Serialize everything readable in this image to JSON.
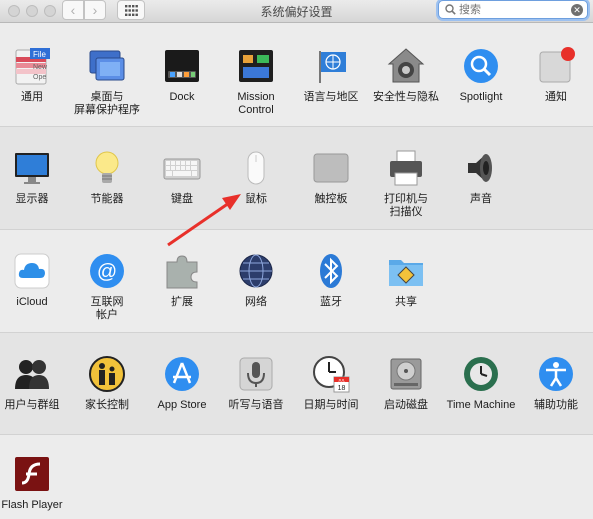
{
  "window": {
    "title": "系统偏好设置"
  },
  "toolbar": {
    "back": "‹",
    "forward": "›"
  },
  "search": {
    "placeholder": "搜索",
    "clear": "✕"
  },
  "rows": [
    [
      {
        "label": "通用",
        "icon": "general-icon"
      },
      {
        "label": "桌面与\n屏幕保护程序",
        "icon": "desktop-screensaver-icon"
      },
      {
        "label": "Dock",
        "icon": "dock-icon"
      },
      {
        "label": "Mission\nControl",
        "icon": "mission-control-icon"
      },
      {
        "label": "语言与地区",
        "icon": "language-region-icon"
      },
      {
        "label": "安全性与隐私",
        "icon": "security-privacy-icon"
      },
      {
        "label": "Spotlight",
        "icon": "spotlight-icon"
      },
      {
        "label": "通知",
        "icon": "notifications-icon"
      }
    ],
    [
      {
        "label": "显示器",
        "icon": "displays-icon"
      },
      {
        "label": "节能器",
        "icon": "energy-saver-icon"
      },
      {
        "label": "键盘",
        "icon": "keyboard-icon"
      },
      {
        "label": "鼠标",
        "icon": "mouse-icon"
      },
      {
        "label": "触控板",
        "icon": "trackpad-icon"
      },
      {
        "label": "打印机与\n扫描仪",
        "icon": "printers-scanners-icon"
      },
      {
        "label": "声音",
        "icon": "sound-icon"
      }
    ],
    [
      {
        "label": "iCloud",
        "icon": "icloud-icon"
      },
      {
        "label": "互联网\n帐户",
        "icon": "internet-accounts-icon"
      },
      {
        "label": "扩展",
        "icon": "extensions-icon"
      },
      {
        "label": "网络",
        "icon": "network-icon"
      },
      {
        "label": "蓝牙",
        "icon": "bluetooth-icon"
      },
      {
        "label": "共享",
        "icon": "sharing-icon"
      }
    ],
    [
      {
        "label": "用户与群组",
        "icon": "users-groups-icon"
      },
      {
        "label": "家长控制",
        "icon": "parental-controls-icon"
      },
      {
        "label": "App Store",
        "icon": "app-store-icon"
      },
      {
        "label": "听写与语音",
        "icon": "dictation-speech-icon"
      },
      {
        "label": "日期与时间",
        "icon": "date-time-icon"
      },
      {
        "label": "启动磁盘",
        "icon": "startup-disk-icon"
      },
      {
        "label": "Time Machine",
        "icon": "time-machine-icon"
      },
      {
        "label": "辅助功能",
        "icon": "accessibility-icon"
      }
    ],
    [
      {
        "label": "Flash Player",
        "icon": "flash-player-icon"
      }
    ]
  ],
  "icon_text": {
    "file_badge": "File",
    "file_new": "New",
    "file_ope": "Ope",
    "calendar_jul": "JUL",
    "calendar_day": "18"
  },
  "annotation": {
    "arrow_color": "#e8302a",
    "target": "mouse-icon"
  }
}
